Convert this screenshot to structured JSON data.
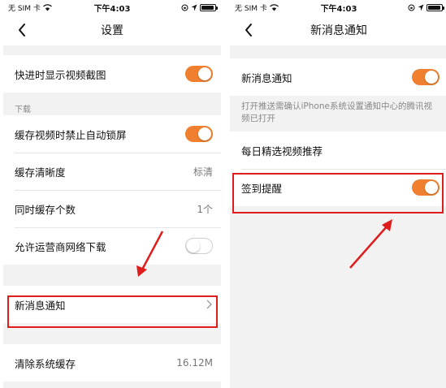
{
  "status_bar": {
    "carrier": "无 SIM 卡",
    "time": "下午4:03",
    "battery_level": 0.95
  },
  "left": {
    "title": "设置",
    "rows_top": [
      {
        "label": "快进时显示视频截图",
        "toggle": "on"
      }
    ],
    "section_download": {
      "header": "下载",
      "rows": [
        {
          "label": "缓存视频时禁止自动锁屏",
          "toggle": "on"
        },
        {
          "label": "缓存清晰度",
          "value": "标清"
        },
        {
          "label": "同时缓存个数",
          "value": "1个"
        },
        {
          "label": "允许运营商网络下载",
          "toggle": "off"
        }
      ]
    },
    "notification_row": {
      "label": "新消息通知"
    },
    "cache_row": {
      "label": "清除系统缓存",
      "value": "16.12M"
    }
  },
  "right": {
    "title": "新消息通知",
    "notification_row": {
      "label": "新消息通知",
      "toggle": "on"
    },
    "note": "打开推送需确认iPhone系统设置通知中心的腾讯视频已打开",
    "rows": [
      {
        "label": "每日精选视频推荐"
      },
      {
        "label": "签到提醒",
        "toggle": "on"
      }
    ]
  },
  "colors": {
    "toggle_on": "#f0802f",
    "highlight": "#e01d1d"
  },
  "icons": [
    "back-icon",
    "chevron-right-icon",
    "wifi-icon",
    "lock-rotation-icon",
    "location-icon",
    "battery-icon"
  ]
}
